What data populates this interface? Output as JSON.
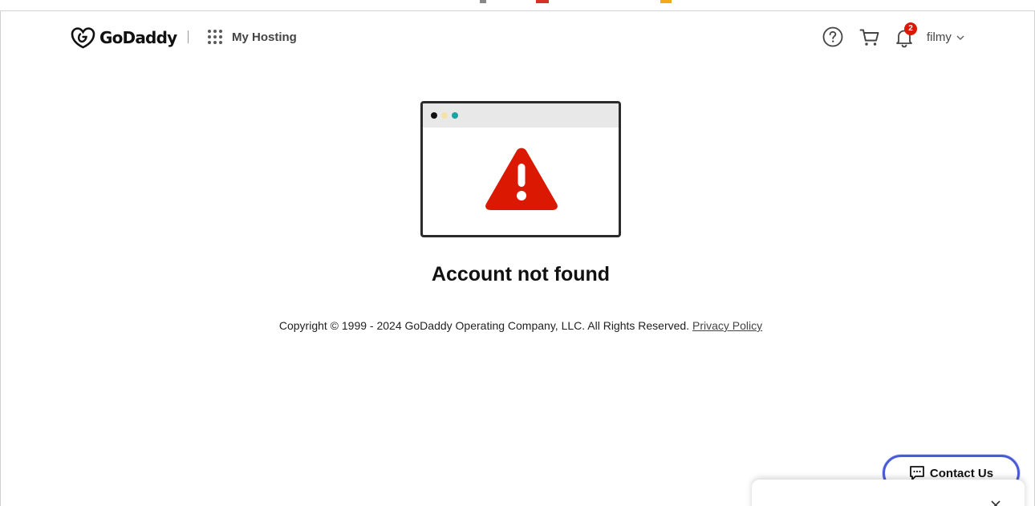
{
  "header": {
    "logo_text": "GoDaddy",
    "product_link": "My Hosting",
    "notification_count": "2",
    "user_name": "filmy"
  },
  "main": {
    "title": "Account not found",
    "illustration_dots": [
      "#111111",
      "#f4e3a8",
      "#1aa3a3"
    ],
    "warning_color": "#db1802"
  },
  "footer": {
    "copyright": "Copyright © 1999 - 2024 GoDaddy Operating Company, LLC. All Rights Reserved.",
    "privacy_link": "Privacy Policy"
  },
  "contact": {
    "label": "Contact Us"
  },
  "colors": {
    "badge": "#db1802",
    "contact_border": "#4a5bd4"
  }
}
